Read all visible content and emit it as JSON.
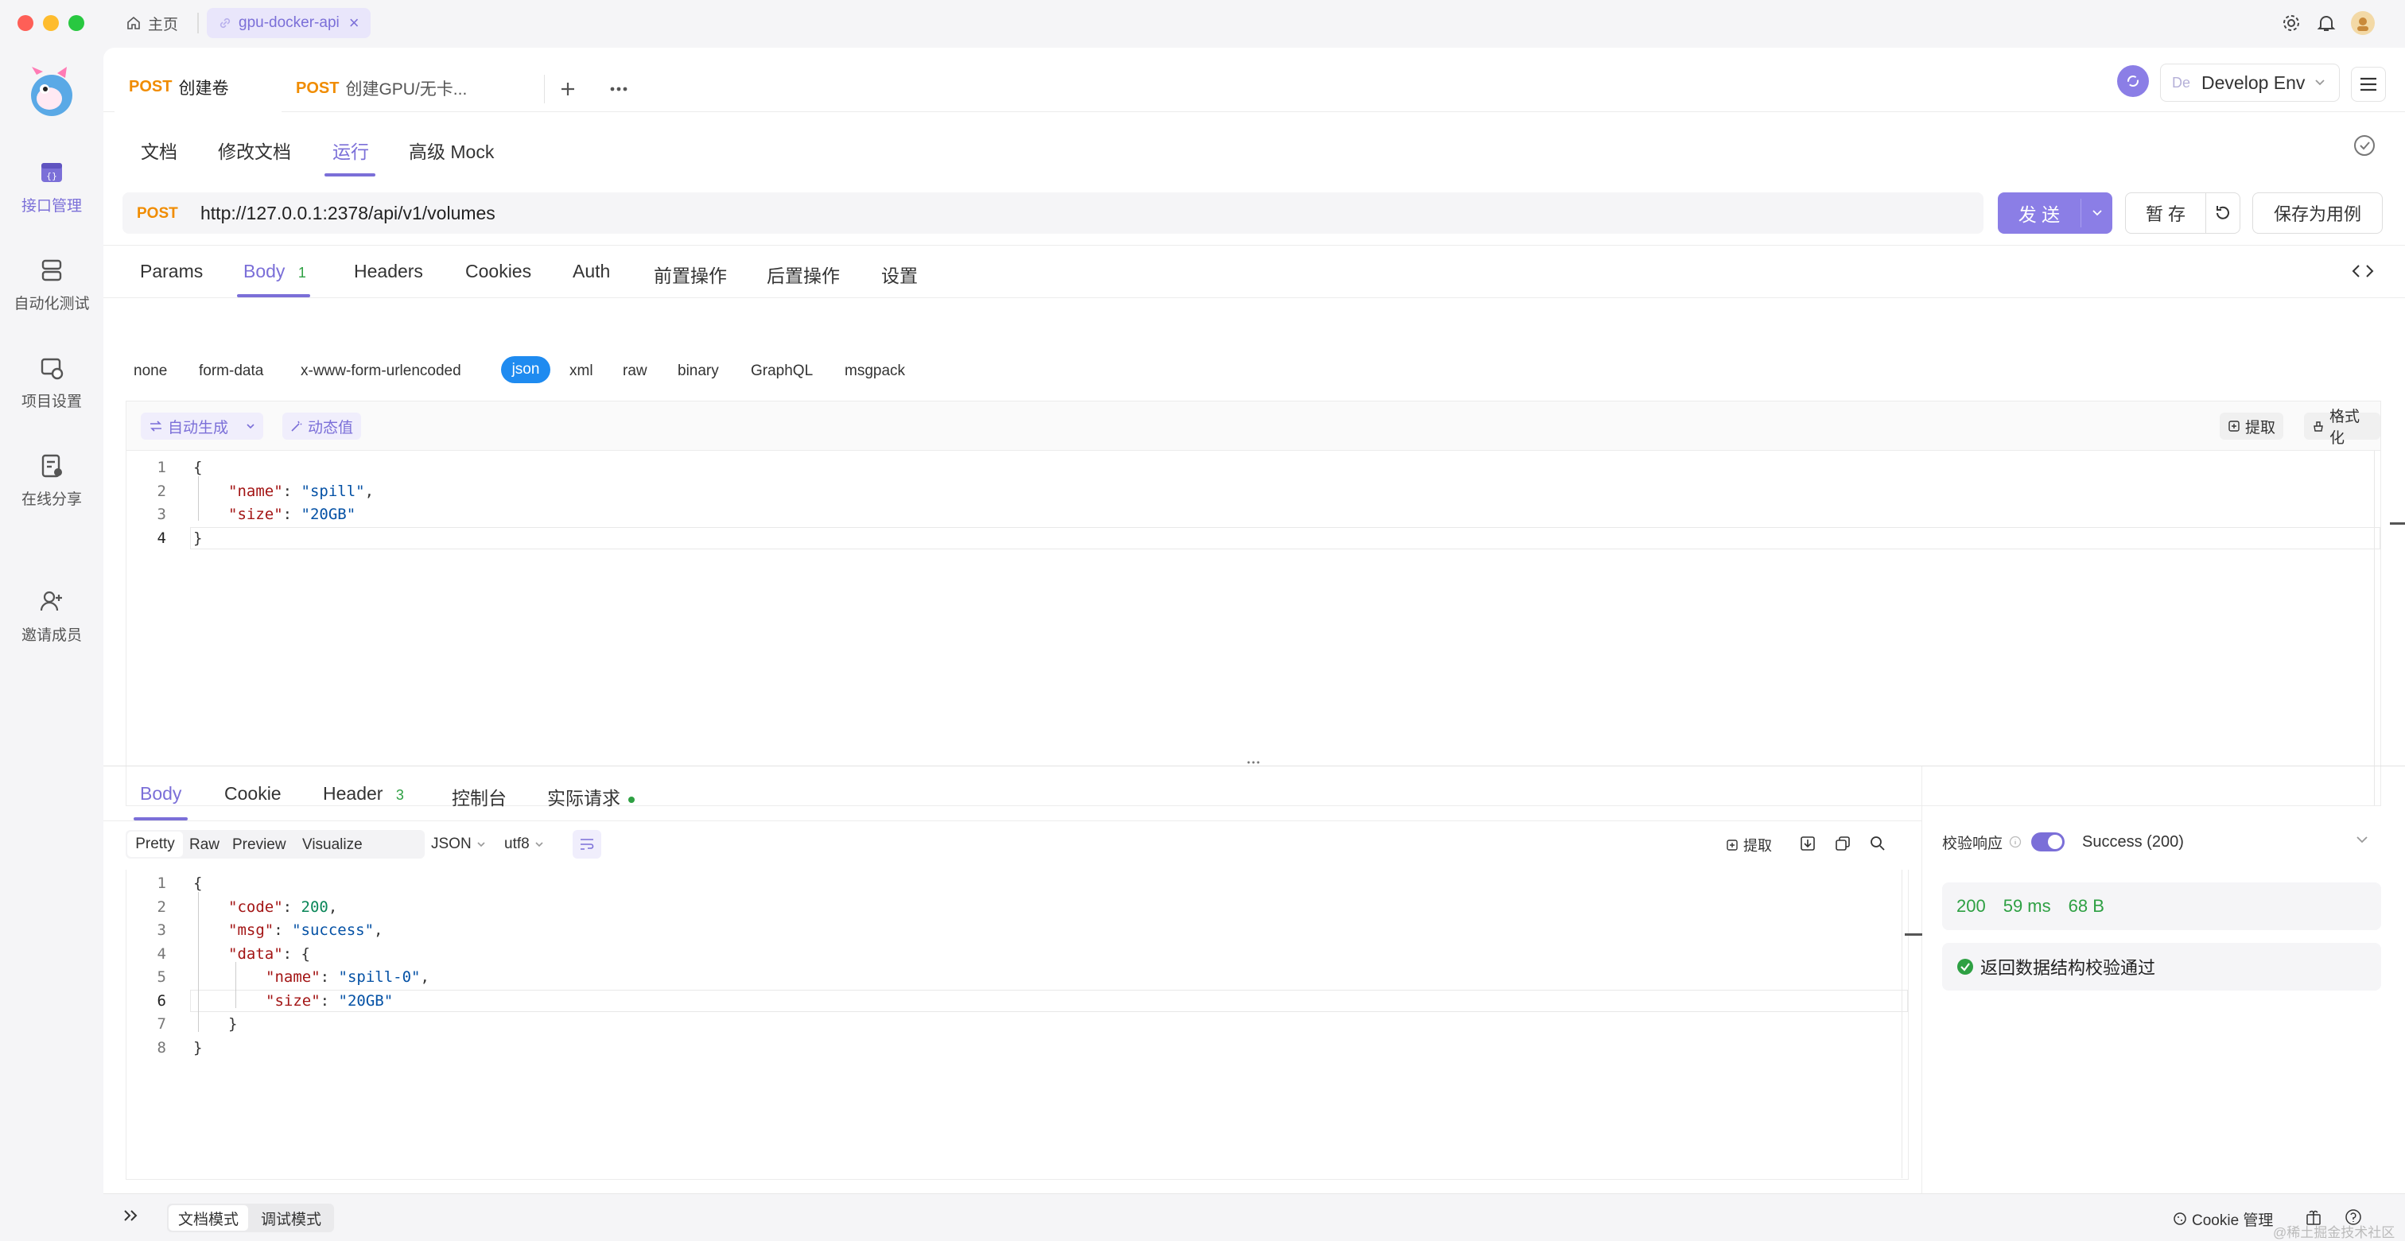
{
  "window": {
    "home_tab": "主页",
    "project_tab": "gpu-docker-api",
    "close_glyph": "×"
  },
  "rail": {
    "items": [
      {
        "label": "接口管理",
        "icon": "api-icon"
      },
      {
        "label": "自动化测试",
        "icon": "database-icon"
      },
      {
        "label": "项目设置",
        "icon": "settings-icon"
      },
      {
        "label": "在线分享",
        "icon": "share-icon"
      },
      {
        "label": "邀请成员",
        "icon": "invite-icon"
      }
    ]
  },
  "request_tabs": [
    {
      "method": "POST",
      "name": "创建卷"
    },
    {
      "method": "POST",
      "name": "创建GPU/无卡..."
    }
  ],
  "env": {
    "badge": "De",
    "name": "Develop Env"
  },
  "subtabs": [
    "文档",
    "修改文档",
    "运行",
    "高级 Mock"
  ],
  "request": {
    "method": "POST",
    "url": "http://127.0.0.1:2378/api/v1/volumes",
    "send": "发 送",
    "save_temp": "暂 存",
    "save_case": "保存为用例"
  },
  "param_tabs": [
    {
      "label": "Params"
    },
    {
      "label": "Body",
      "count": "1"
    },
    {
      "label": "Headers"
    },
    {
      "label": "Cookies"
    },
    {
      "label": "Auth"
    },
    {
      "label": "前置操作"
    },
    {
      "label": "后置操作"
    },
    {
      "label": "设置"
    }
  ],
  "body_types": [
    "none",
    "form-data",
    "x-www-form-urlencoded",
    "json",
    "xml",
    "raw",
    "binary",
    "GraphQL",
    "msgpack"
  ],
  "editor_toolbar": {
    "auto_gen": "自动生成",
    "dynamic": "动态值",
    "extract": "提取",
    "format": "格式化"
  },
  "request_body": {
    "line_numbers": [
      "1",
      "2",
      "3",
      "4"
    ],
    "open": "{",
    "name_key": "\"name\"",
    "name_val": "\"spill\"",
    "size_key": "\"size\"",
    "size_val": "\"20GB\"",
    "close": "}"
  },
  "response_tabs": [
    {
      "label": "Body"
    },
    {
      "label": "Cookie"
    },
    {
      "label": "Header",
      "count": "3"
    },
    {
      "label": "控制台"
    },
    {
      "label": "实际请求"
    }
  ],
  "view_modes": [
    "Pretty",
    "Raw",
    "Preview",
    "Visualize"
  ],
  "format_select": "JSON",
  "encoding_select": "utf8",
  "response_toolbar": {
    "extract": "提取"
  },
  "response_body": {
    "line_numbers": [
      "1",
      "2",
      "3",
      "4",
      "5",
      "6",
      "7",
      "8"
    ],
    "l1": "{",
    "code_key": "\"code\"",
    "code_val": "200",
    "msg_key": "\"msg\"",
    "msg_val": "\"success\"",
    "data_key": "\"data\"",
    "data_open": "{",
    "name_key": "\"name\"",
    "name_val": "\"spill-0\"",
    "size_key": "\"size\"",
    "size_val": "\"20GB\"",
    "data_close": "}",
    "l8": "}"
  },
  "validation": {
    "label": "校验响应",
    "status": "Success (200)",
    "code": "200",
    "time": "59 ms",
    "size": "68 B",
    "message": "返回数据结构校验通过"
  },
  "bottom": {
    "doc_mode": "文档模式",
    "debug_mode": "调试模式",
    "cookie_mgmt": "Cookie 管理",
    "watermark": "@稀土掘金技术社区"
  },
  "colors": {
    "accent": "#7b6fd8",
    "method": "#f08c00",
    "success": "#2ea043"
  }
}
